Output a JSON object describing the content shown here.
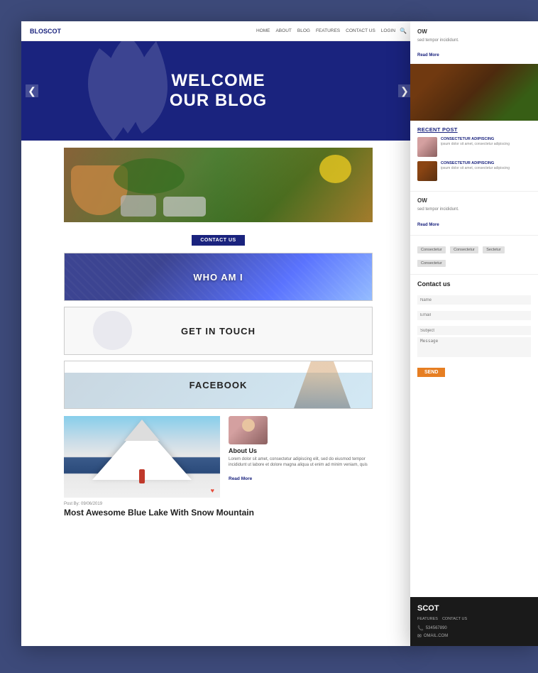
{
  "navbar": {
    "brand": "BLOSCOT",
    "links": [
      "HOME",
      "ABOUT",
      "BLOG",
      "FEATURES",
      "CONTACT US",
      "LOGIN"
    ],
    "search_icon": "🔍"
  },
  "hero": {
    "line1": "WELCOME",
    "line2": "OUR BLOG",
    "arrow_left": "❮",
    "arrow_right": "❯"
  },
  "contact_button": "CONTACT US",
  "widgets": [
    {
      "label": "WHO AM I",
      "type": "dark-bg"
    },
    {
      "label": "GET IN TOUCH",
      "type": "light-bg"
    },
    {
      "label": "FACEBOOK",
      "type": "photo-bg"
    }
  ],
  "blog": {
    "post_meta": "Post By: 09/06/2019",
    "post_title": "Most Awesome Blue Lake With Snow Mountain",
    "about_title": "About Us",
    "about_text": "Lorem dolor sit amet, consectetur adipiscing elit, sed do eiusmod tempor incididunt ut labore et dolore magna aliqua ut enim ad minim veniam, quis",
    "read_more": "Read More"
  },
  "right_panel": {
    "top_section": {
      "title": "OW",
      "text": "sed tempor incididunt.",
      "read_more": "Read More"
    },
    "recent_post": {
      "title": "RECENT POST",
      "items": [
        {
          "heading": "CONSECTETUR ADIPISCING",
          "desc": "ipsum dolor sit amet, consectetur adipiscing"
        },
        {
          "heading": "CONSECTETUR ADIPISCING",
          "desc": "ipsum dolor sit amet, consectetur adipiscing"
        }
      ]
    },
    "second_section": {
      "title": "OW",
      "text": "sed tempor incididunt.",
      "read_more": "Read More"
    },
    "tags": [
      "Consectetur",
      "Consectetur",
      "Sectetur",
      "Consectetur"
    ],
    "contact_form": {
      "title": "Contact us",
      "name_placeholder": "Name",
      "email_placeholder": "Email",
      "subject_placeholder": "Subject",
      "message_placeholder": "Message",
      "send_label": "SEND"
    },
    "footer": {
      "brand": "SCOT",
      "links": [
        "FEATURES",
        "CONTACT US"
      ],
      "phone": "534567890",
      "email": "OMAIL.COM"
    }
  }
}
